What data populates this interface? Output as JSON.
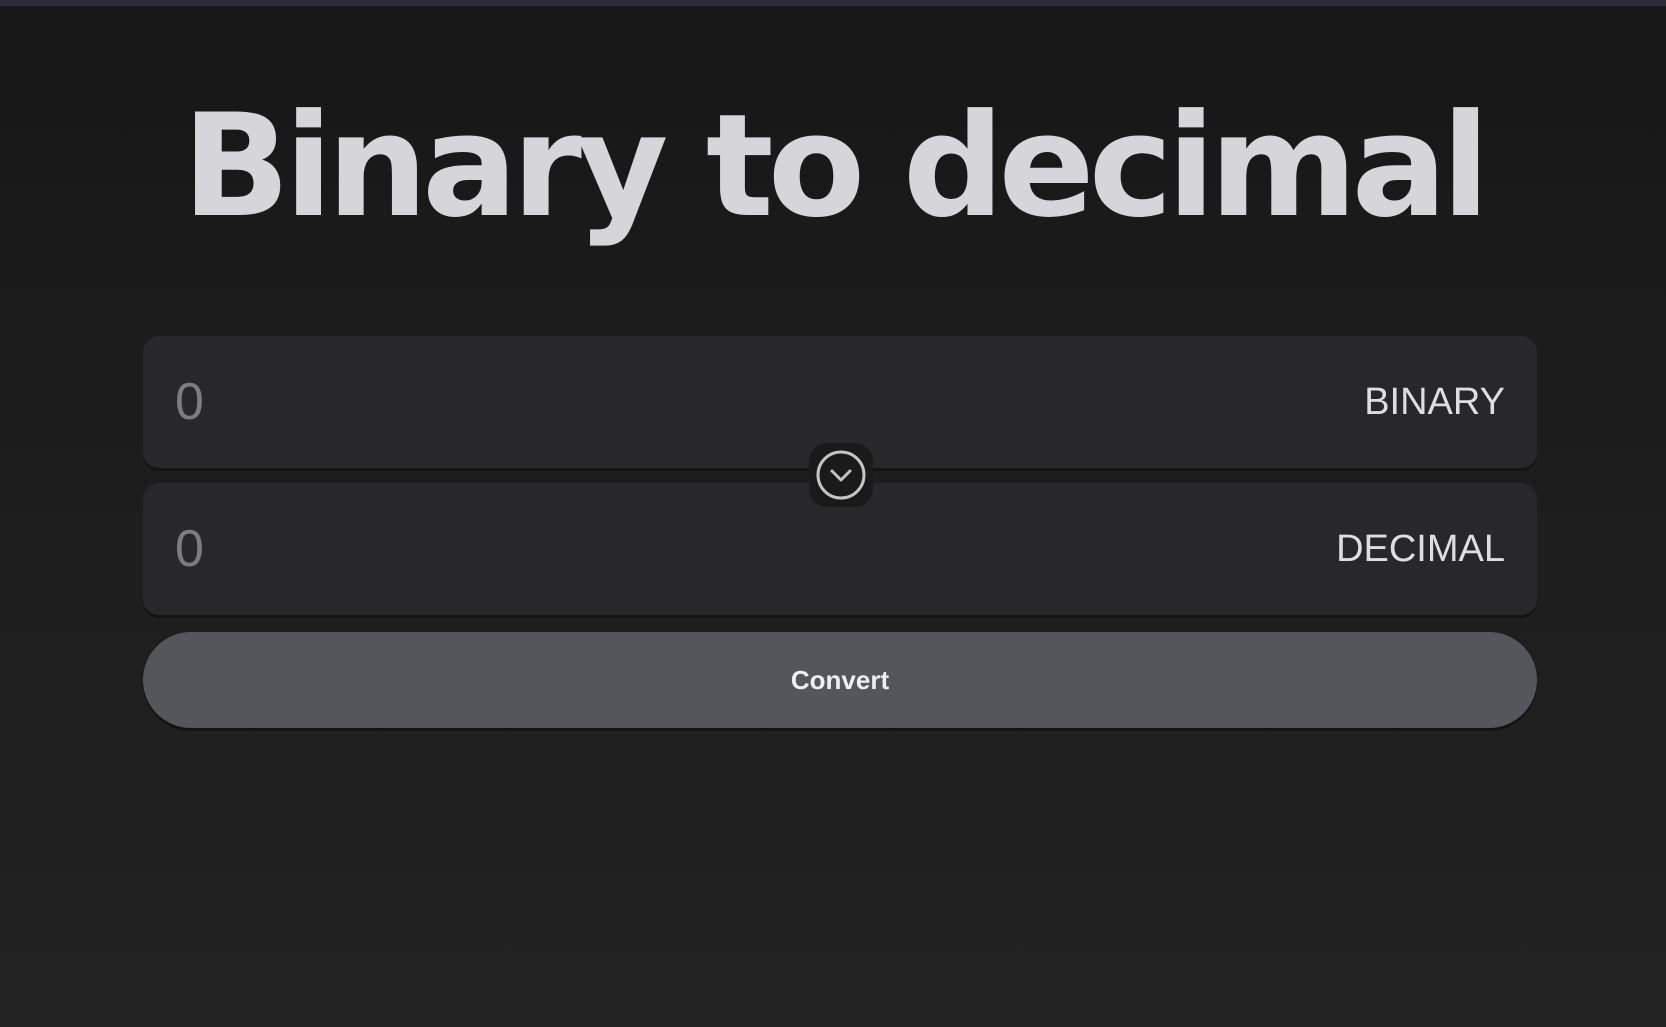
{
  "page": {
    "title": "Binary to decimal"
  },
  "binary_field": {
    "placeholder": "0",
    "value": "",
    "label": "BINARY"
  },
  "decimal_field": {
    "placeholder": "0",
    "value": "",
    "label": "DECIMAL"
  },
  "swap": {
    "icon": "chevron-down-circle-icon"
  },
  "convert_button": {
    "label": "Convert"
  },
  "colors": {
    "background": "#1e1e1e",
    "field_background": "#28282b",
    "title_text": "#d5d5da",
    "placeholder_text": "#7d7d80",
    "button_background": "#55565c"
  }
}
